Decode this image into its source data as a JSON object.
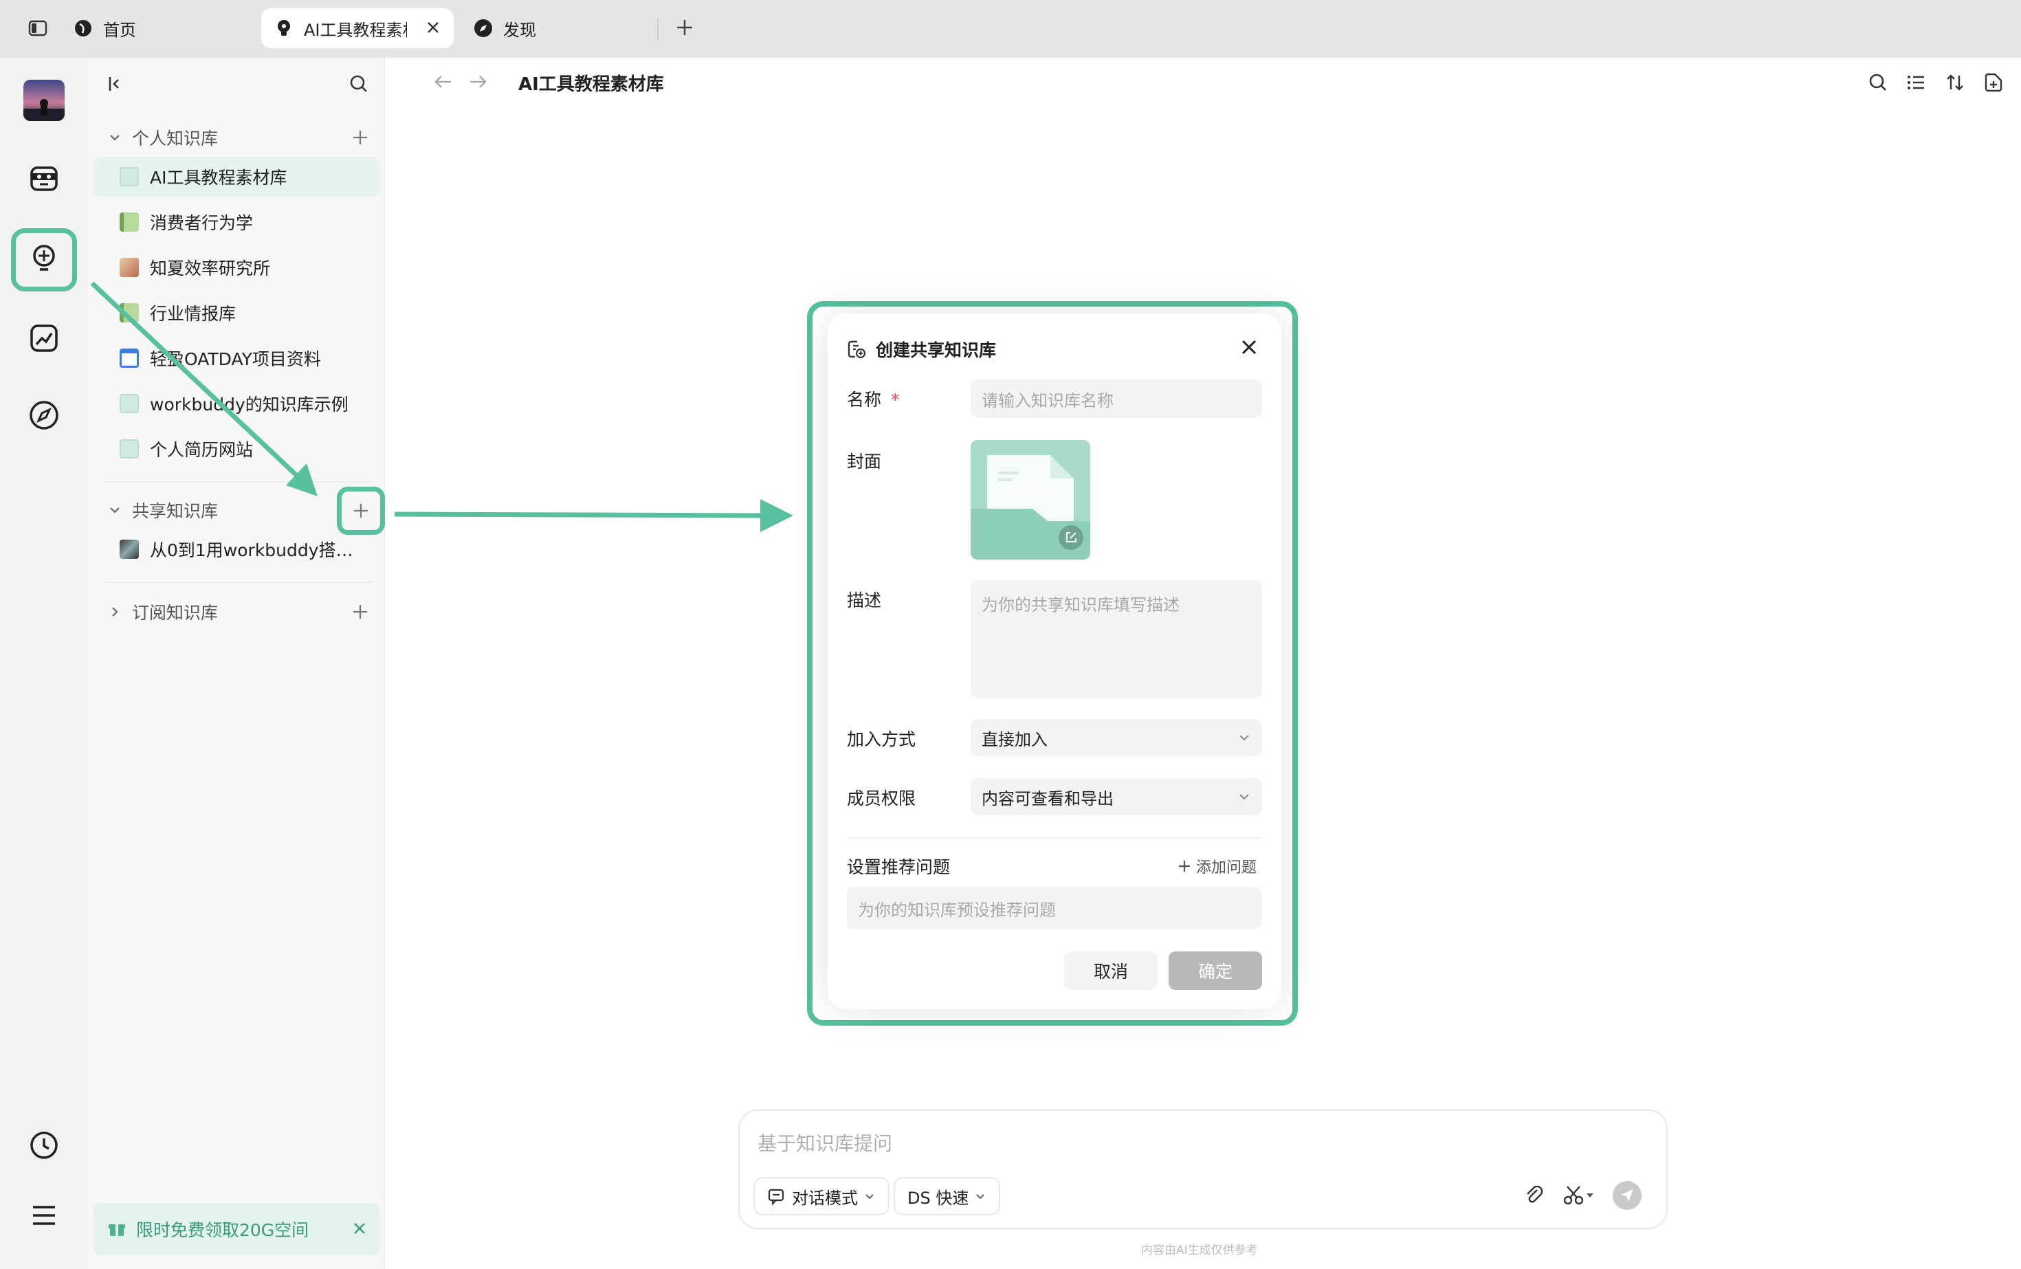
{
  "tabs": [
    {
      "label": "首页"
    },
    {
      "label": "AI工具教程素材库"
    },
    {
      "label": "发现"
    }
  ],
  "page_title": "AI工具教程素材库",
  "sidebar": {
    "personal_section": "个人知识库",
    "personal_items": [
      {
        "label": "AI工具教程素材库"
      },
      {
        "label": "消费者行为学"
      },
      {
        "label": "知夏效率研究所"
      },
      {
        "label": "行业情报库"
      },
      {
        "label": "轻盈OATDAY项目资料"
      },
      {
        "label": "workbuddy的知识库示例"
      },
      {
        "label": "个人简历网站"
      }
    ],
    "shared_section": "共享知识库",
    "shared_items": [
      {
        "label": "从0到1用workbuddy搭建i..."
      }
    ],
    "subscribed_section": "订阅知识库",
    "promo": "限时免费领取20G空间"
  },
  "dialog": {
    "title": "创建共享知识库",
    "name_label": "名称",
    "required_mark": "*",
    "name_placeholder": "请输入知识库名称",
    "cover_label": "封面",
    "desc_label": "描述",
    "desc_placeholder": "为你的共享知识库填写描述",
    "join_label": "加入方式",
    "join_value": "直接加入",
    "perm_label": "成员权限",
    "perm_value": "内容可查看和导出",
    "recommend_label": "设置推荐问题",
    "add_question": "添加问题",
    "question_placeholder": "为你的知识库预设推荐问题",
    "cancel": "取消",
    "confirm": "确定"
  },
  "chat": {
    "placeholder": "基于知识库提问",
    "mode": "对话模式",
    "model": "DS 快速",
    "footer": "内容由AI生成仅供参考"
  },
  "colors": {
    "accent": "#56c0a0",
    "confirm_disabled": "#b9b9b9"
  }
}
